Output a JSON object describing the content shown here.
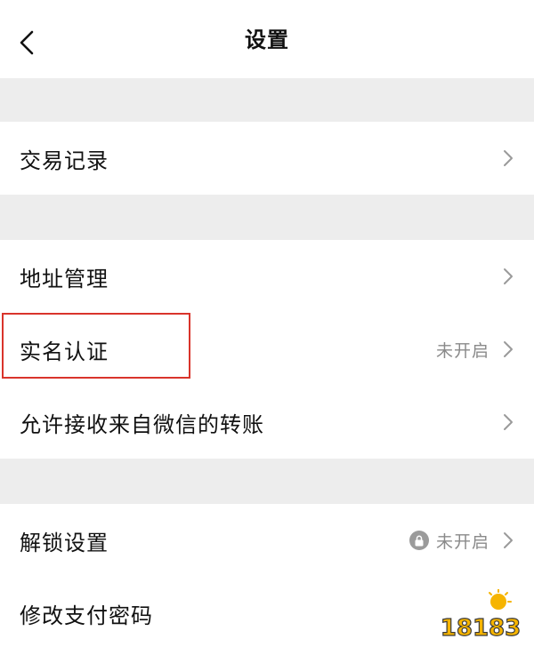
{
  "header": {
    "title": "设置",
    "back_icon": "chevron-left-icon"
  },
  "rows": {
    "transaction_records": {
      "label": "交易记录"
    },
    "address_management": {
      "label": "地址管理"
    },
    "real_name_verification": {
      "label": "实名认证",
      "status": "未开启"
    },
    "allow_wechat_transfer": {
      "label": "允许接收来自微信的转账"
    },
    "unlock_settings": {
      "label": "解锁设置",
      "status": "未开启",
      "icon": "lock-icon"
    },
    "change_payment_password": {
      "label": "修改支付密码"
    }
  },
  "colors": {
    "background": "#ffffff",
    "separator": "#ededed",
    "highlight": "#d9342b",
    "muted_text": "#8a8a8a"
  },
  "watermark": {
    "text": "18183",
    "icon": "watermark-logo"
  }
}
